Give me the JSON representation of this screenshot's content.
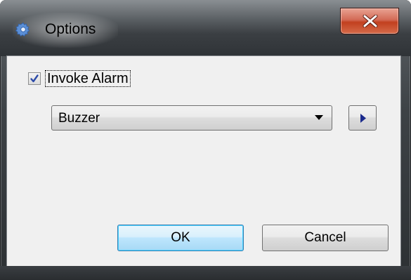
{
  "window": {
    "title": "Options",
    "title_icon": "gear-icon",
    "close_icon": "close-icon"
  },
  "invoke_alarm": {
    "label": "Invoke Alarm",
    "checked": true
  },
  "alarm_select": {
    "value": "Buzzer",
    "arrow_icon": "chevron-down-icon"
  },
  "play_button": {
    "icon": "play-icon",
    "icon_color": "#1a2a8c"
  },
  "buttons": {
    "ok_label": "OK",
    "cancel_label": "Cancel"
  },
  "colors": {
    "close_button": "#c8452a",
    "default_button_border": "#3c7fb1",
    "dialog_background": "#f0f0f0"
  }
}
